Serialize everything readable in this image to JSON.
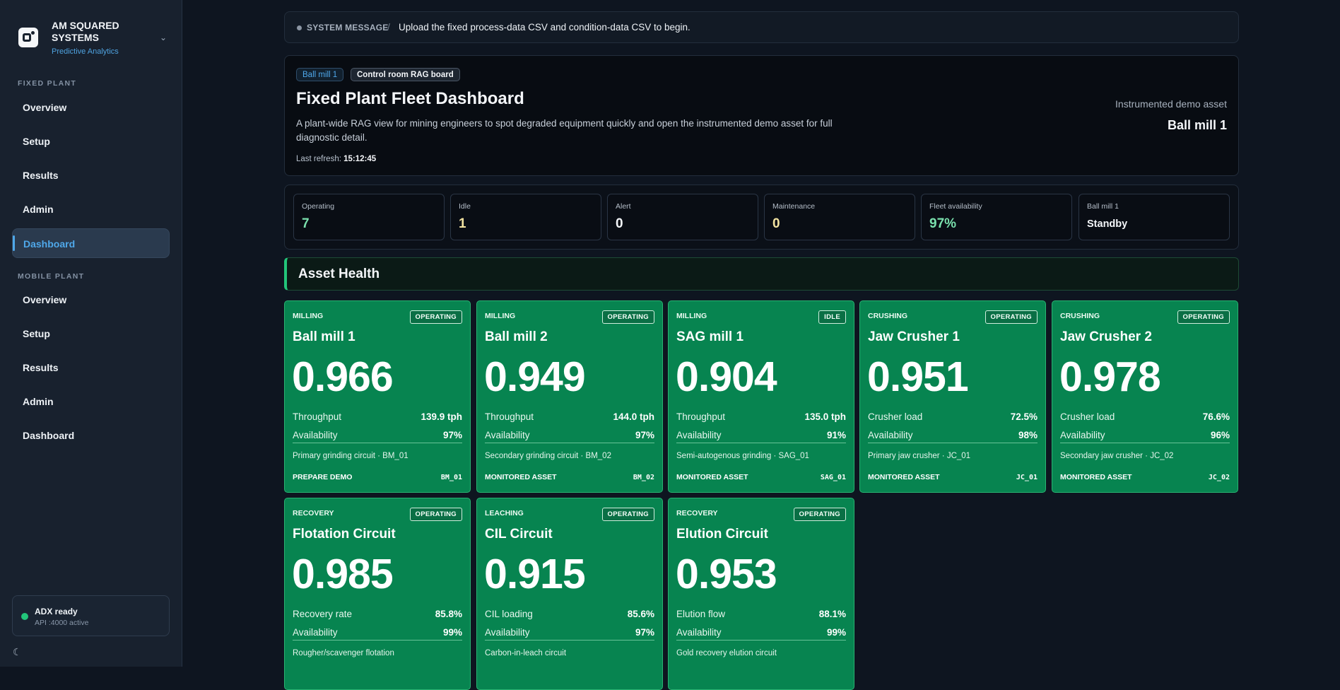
{
  "brand": {
    "name": "AM SQUARED SYSTEMS",
    "subtitle": "Predictive Analytics"
  },
  "sidebar": {
    "fixed_label": "FIXED PLANT",
    "fixed_items": [
      "Overview",
      "Setup",
      "Results",
      "Admin",
      "Dashboard"
    ],
    "mobile_label": "MOBILE PLANT",
    "mobile_items": [
      "Overview",
      "Setup",
      "Results",
      "Admin",
      "Dashboard"
    ],
    "status_title": "ADX ready",
    "status_sub": "API :4000 active"
  },
  "system_message": {
    "label": "SYSTEM MESSAGE",
    "separator": "/",
    "text": "Upload the fixed process-data CSV and condition-data CSV to begin."
  },
  "hero": {
    "chip_asset": "Ball mill 1",
    "chip_board": "Control room RAG board",
    "title": "Fixed Plant Fleet Dashboard",
    "description": "A plant-wide RAG view for mining engineers to spot degraded equipment quickly and open the instrumented demo asset for full diagnostic detail.",
    "refresh_label": "Last refresh:",
    "refresh_time": "15:12:45",
    "right_label": "Instrumented demo asset",
    "right_value": "Ball mill 1"
  },
  "kpis": [
    {
      "label": "Operating",
      "value": "7"
    },
    {
      "label": "Idle",
      "value": "1"
    },
    {
      "label": "Alert",
      "value": "0"
    },
    {
      "label": "Maintenance",
      "value": "0"
    },
    {
      "label": "Fleet availability",
      "value": "97%"
    },
    {
      "label": "Ball mill 1",
      "value": "Standby"
    }
  ],
  "asset_health_title": "Asset Health",
  "cards": [
    {
      "category": "MILLING",
      "status": "OPERATING",
      "name": "Ball mill 1",
      "score": "0.966",
      "m1_label": "Throughput",
      "m1_value": "139.9 tph",
      "m2_label": "Availability",
      "m2_value": "97%",
      "desc": "Primary grinding circuit · BM_01",
      "foot": "PREPARE DEMO",
      "code": "BM_01"
    },
    {
      "category": "MILLING",
      "status": "OPERATING",
      "name": "Ball mill 2",
      "score": "0.949",
      "m1_label": "Throughput",
      "m1_value": "144.0 tph",
      "m2_label": "Availability",
      "m2_value": "97%",
      "desc": "Secondary grinding circuit · BM_02",
      "foot": "MONITORED ASSET",
      "code": "BM_02"
    },
    {
      "category": "MILLING",
      "status": "IDLE",
      "name": "SAG mill 1",
      "score": "0.904",
      "m1_label": "Throughput",
      "m1_value": "135.0 tph",
      "m2_label": "Availability",
      "m2_value": "91%",
      "desc": "Semi-autogenous grinding · SAG_01",
      "foot": "MONITORED ASSET",
      "code": "SAG_01"
    },
    {
      "category": "CRUSHING",
      "status": "OPERATING",
      "name": "Jaw Crusher 1",
      "score": "0.951",
      "m1_label": "Crusher load",
      "m1_value": "72.5%",
      "m2_label": "Availability",
      "m2_value": "98%",
      "desc": "Primary jaw crusher · JC_01",
      "foot": "MONITORED ASSET",
      "code": "JC_01"
    },
    {
      "category": "CRUSHING",
      "status": "OPERATING",
      "name": "Jaw Crusher 2",
      "score": "0.978",
      "m1_label": "Crusher load",
      "m1_value": "76.6%",
      "m2_label": "Availability",
      "m2_value": "96%",
      "desc": "Secondary jaw crusher · JC_02",
      "foot": "MONITORED ASSET",
      "code": "JC_02"
    },
    {
      "category": "RECOVERY",
      "status": "OPERATING",
      "name": "Flotation Circuit",
      "score": "0.985",
      "m1_label": "Recovery rate",
      "m1_value": "85.8%",
      "m2_label": "Availability",
      "m2_value": "99%",
      "desc": "Rougher/scavenger flotation",
      "foot": "",
      "code": ""
    },
    {
      "category": "LEACHING",
      "status": "OPERATING",
      "name": "CIL Circuit",
      "score": "0.915",
      "m1_label": "CIL loading",
      "m1_value": "85.6%",
      "m2_label": "Availability",
      "m2_value": "97%",
      "desc": "Carbon-in-leach circuit",
      "foot": "",
      "code": ""
    },
    {
      "category": "RECOVERY",
      "status": "OPERATING",
      "name": "Elution Circuit",
      "score": "0.953",
      "m1_label": "Elution flow",
      "m1_value": "88.1%",
      "m2_label": "Availability",
      "m2_value": "99%",
      "desc": "Gold recovery elution circuit",
      "foot": "",
      "code": ""
    }
  ]
}
